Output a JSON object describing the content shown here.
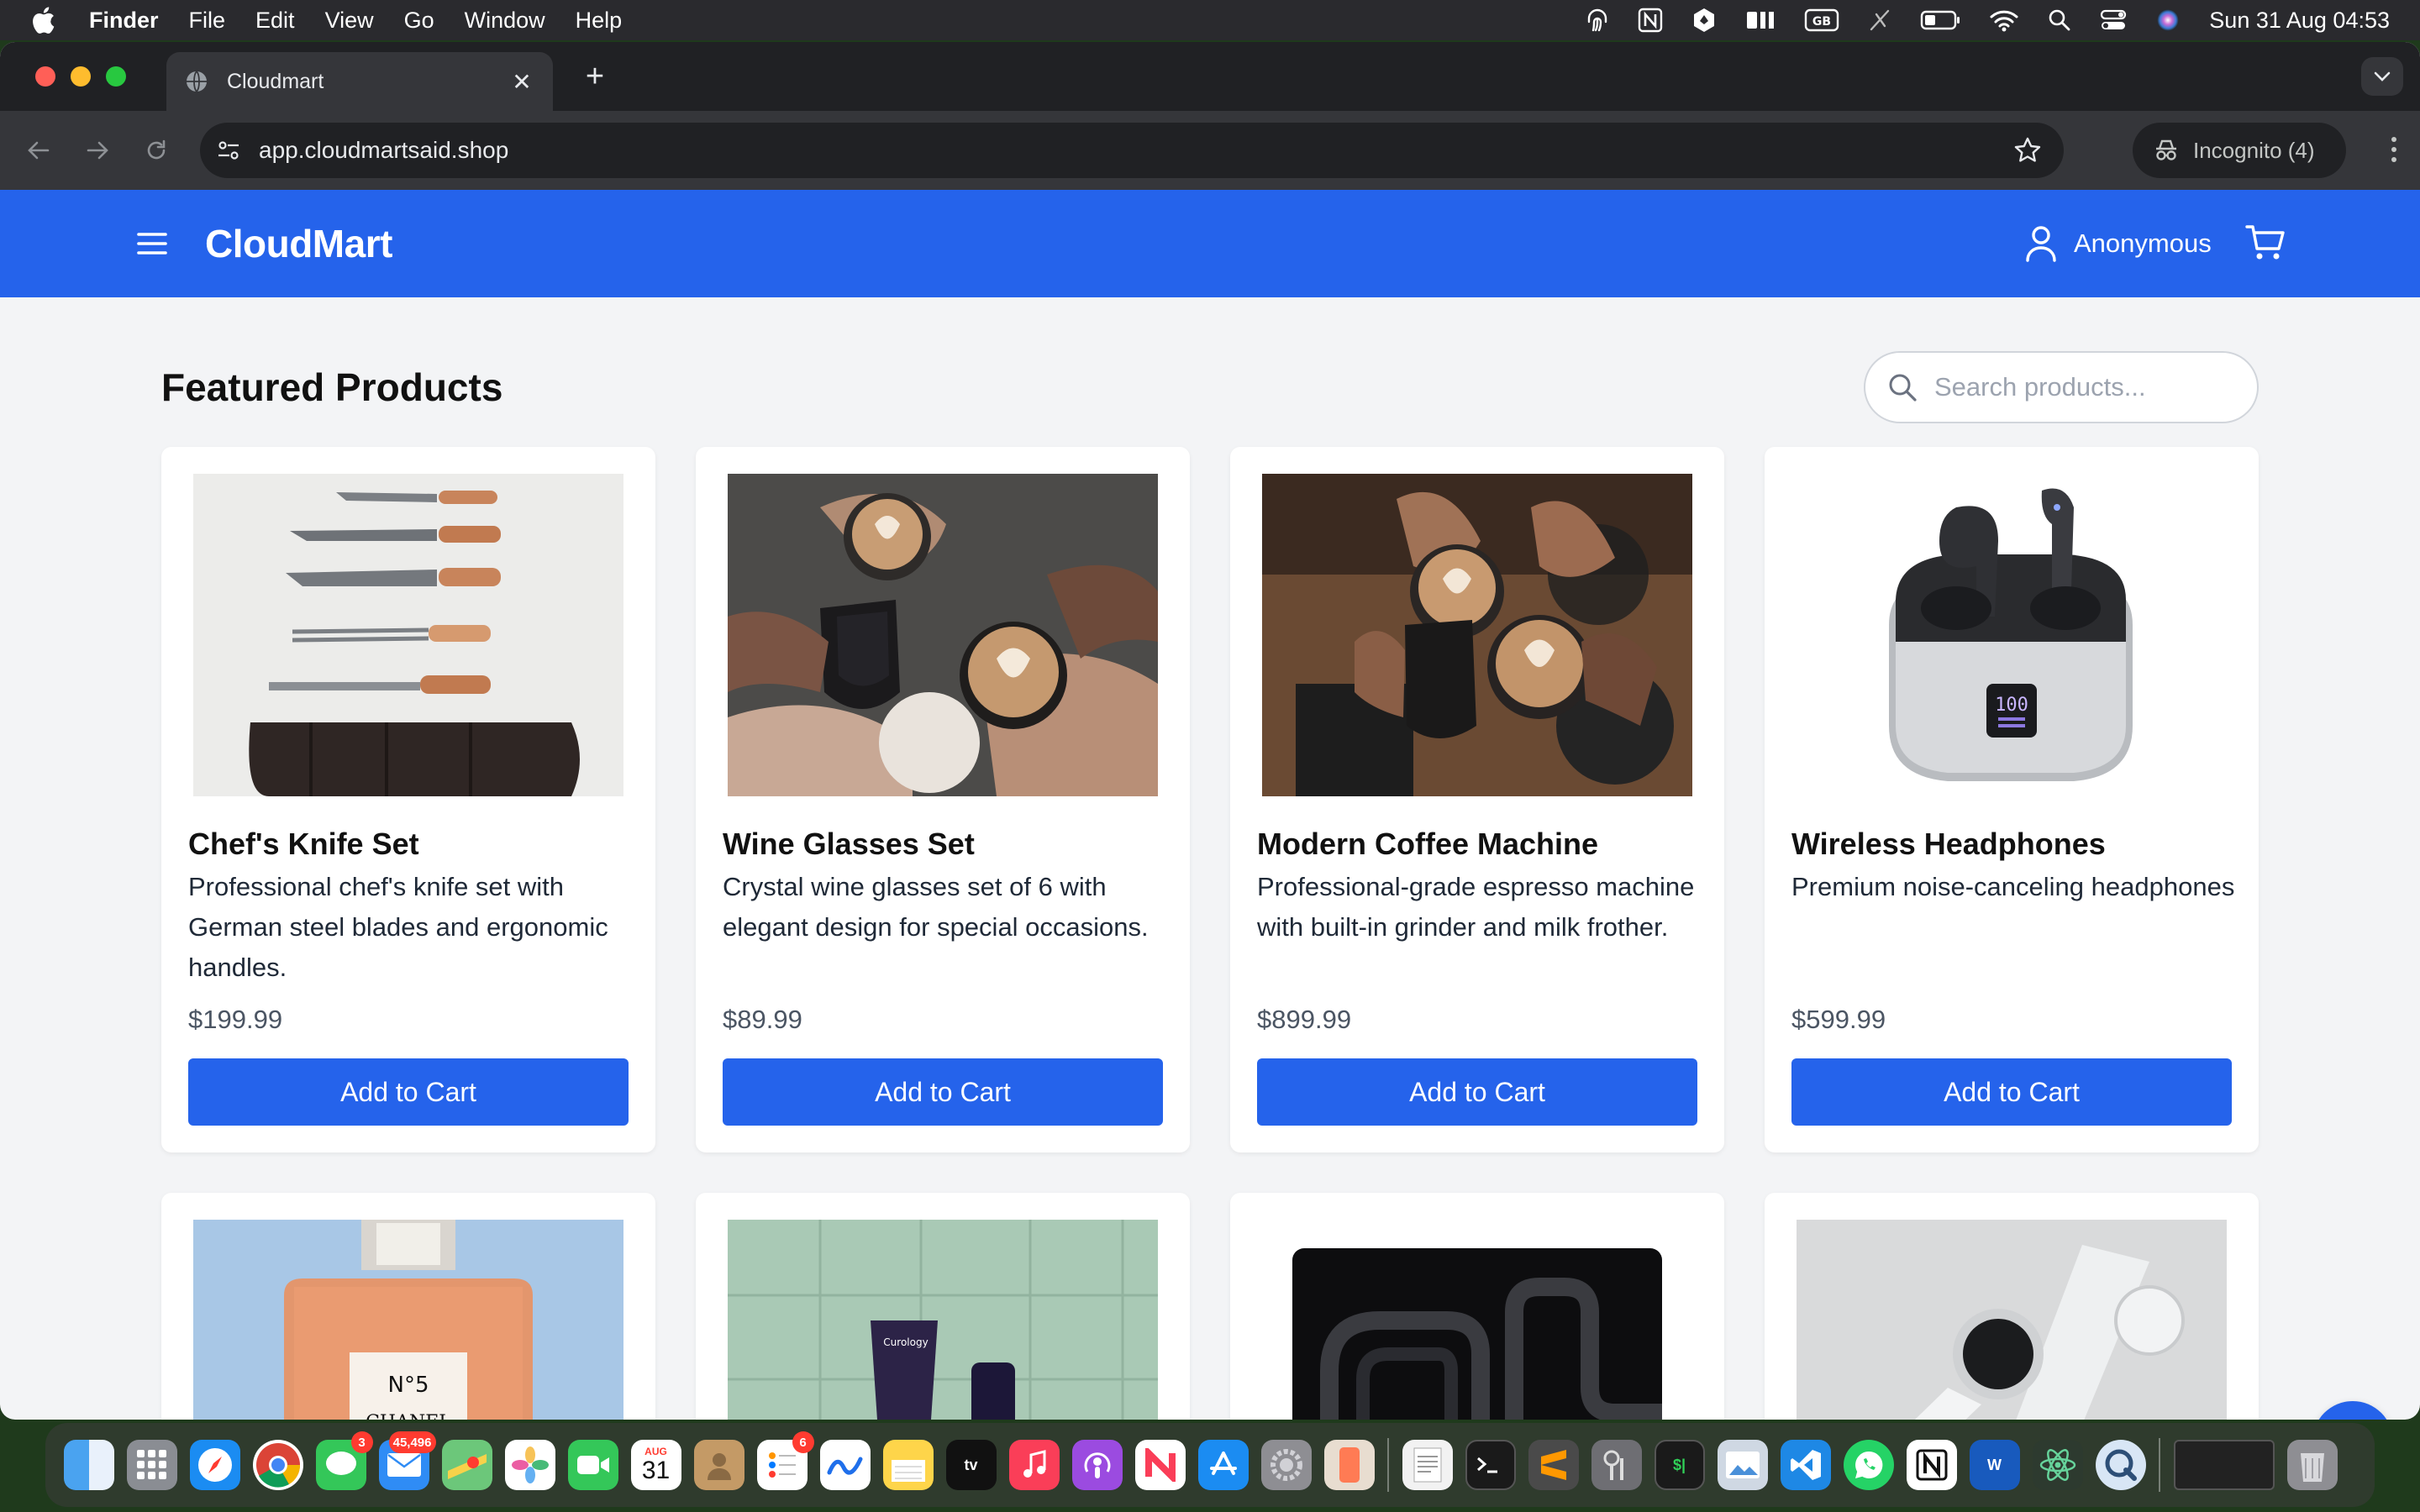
{
  "menubar": {
    "app_name": "Finder",
    "menus": [
      "File",
      "Edit",
      "View",
      "Go",
      "Window",
      "Help"
    ],
    "clock": "Sun 31 Aug  04:53"
  },
  "browser": {
    "tab_title": "Cloudmart",
    "url": "app.cloudmartsaid.shop",
    "incognito_label": "Incognito (4)"
  },
  "header": {
    "brand": "CloudMart",
    "user_label": "Anonymous"
  },
  "main": {
    "title": "Featured Products",
    "search_placeholder": "Search products..."
  },
  "products": [
    {
      "name": "Chef's Knife Set",
      "description": "Professional chef's knife set with German steel blades and ergonomic handles.",
      "price": "$199.99",
      "button": "Add to Cart"
    },
    {
      "name": "Wine Glasses Set",
      "description": "Crystal wine glasses set of 6 with elegant design for special occasions.",
      "price": "$89.99",
      "button": "Add to Cart"
    },
    {
      "name": "Modern Coffee Machine",
      "description": "Professional-grade espresso machine with built-in grinder and milk frother.",
      "price": "$899.99",
      "button": "Add to Cart"
    },
    {
      "name": "Wireless Headphones",
      "description": "Premium noise-canceling headphones",
      "price": "$599.99",
      "button": "Add to Cart"
    }
  ],
  "dock": {
    "calendar_month": "AUG",
    "calendar_day": "31",
    "badges": {
      "messages": "3",
      "mail": "45,496",
      "reminders": "6"
    }
  },
  "colors": {
    "primary": "#2563eb",
    "page_bg": "#f3f4f6",
    "chrome_dark": "#202124",
    "chrome_mid": "#35363a"
  }
}
